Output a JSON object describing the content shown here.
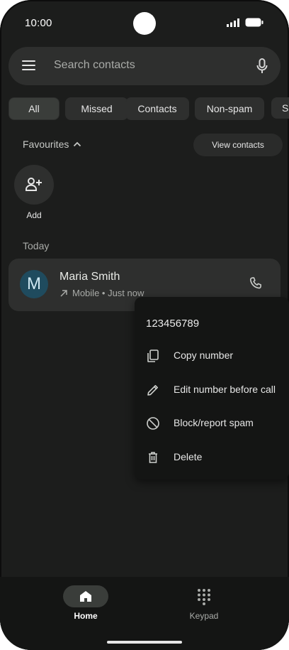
{
  "status": {
    "time": "10:00"
  },
  "search": {
    "placeholder": "Search contacts"
  },
  "filters": [
    "All",
    "Missed",
    "Contacts",
    "Non-spam",
    "S"
  ],
  "favourites": {
    "label": "Favourites",
    "view_contacts": "View contacts",
    "add_label": "Add"
  },
  "recents": {
    "section": "Today",
    "entry": {
      "avatar_letter": "M",
      "name": "Maria Smith",
      "detail": "Mobile • Just now"
    }
  },
  "context_menu": {
    "number": "123456789",
    "items": [
      {
        "label": "Copy number",
        "icon": "copy-icon"
      },
      {
        "label": "Edit number before call",
        "icon": "pencil-icon"
      },
      {
        "label": "Block/report spam",
        "icon": "block-icon"
      },
      {
        "label": "Delete",
        "icon": "trash-icon"
      }
    ]
  },
  "bottom_nav": {
    "home": "Home",
    "keypad": "Keypad"
  },
  "colors": {
    "background": "#1c1d1c",
    "surface": "#2e2f2e",
    "menu": "#141514",
    "avatar": "#1f4b5e"
  }
}
